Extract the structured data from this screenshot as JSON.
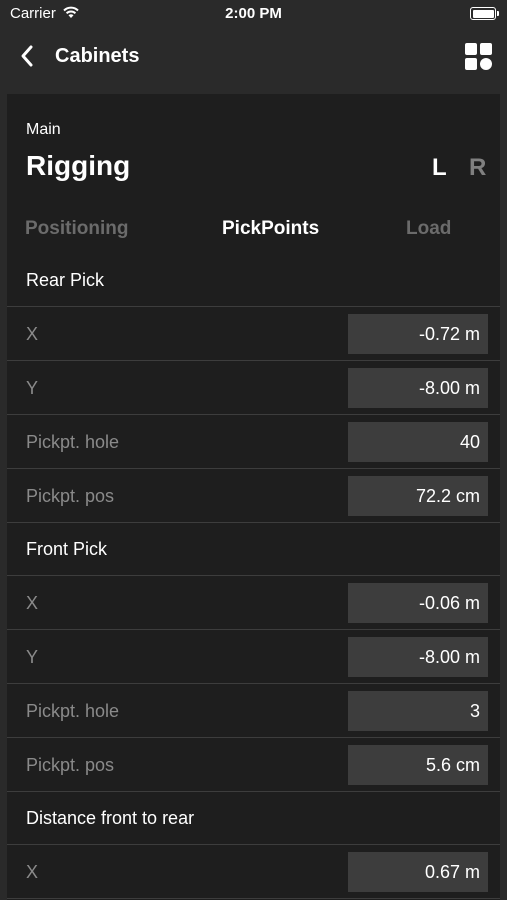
{
  "status_bar": {
    "carrier": "Carrier",
    "time": "2:00 PM"
  },
  "nav": {
    "title": "Cabinets",
    "back_icon": "chevron-left-icon",
    "menu_icon": "grid-icon"
  },
  "header": {
    "subtitle": "Main",
    "title": "Rigging",
    "side_left": "L",
    "side_right": "R",
    "selected_side": "L"
  },
  "tabs": [
    {
      "label": "Positioning",
      "active": false
    },
    {
      "label": "PickPoints",
      "active": true
    },
    {
      "label": "Load",
      "active": false
    }
  ],
  "sections": [
    {
      "title": "Rear Pick",
      "rows": [
        {
          "label": "X",
          "value": "-0.72 m"
        },
        {
          "label": "Y",
          "value": "-8.00 m"
        },
        {
          "label": "Pickpt. hole",
          "value": "40"
        },
        {
          "label": "Pickpt. pos",
          "value": "72.2 cm"
        }
      ]
    },
    {
      "title": "Front Pick",
      "rows": [
        {
          "label": "X",
          "value": "-0.06 m"
        },
        {
          "label": "Y",
          "value": "-8.00 m"
        },
        {
          "label": "Pickpt. hole",
          "value": "3"
        },
        {
          "label": "Pickpt. pos",
          "value": "5.6 cm"
        }
      ]
    },
    {
      "title": "Distance front to rear",
      "rows": [
        {
          "label": "X",
          "value": "0.67 m"
        }
      ]
    }
  ],
  "colors": {
    "background": "#2a2a2a",
    "panel": "#1e1e1e",
    "field": "#3d3d3d",
    "muted_text": "#8a8a8a",
    "inactive_tab": "#6b6b6b"
  }
}
